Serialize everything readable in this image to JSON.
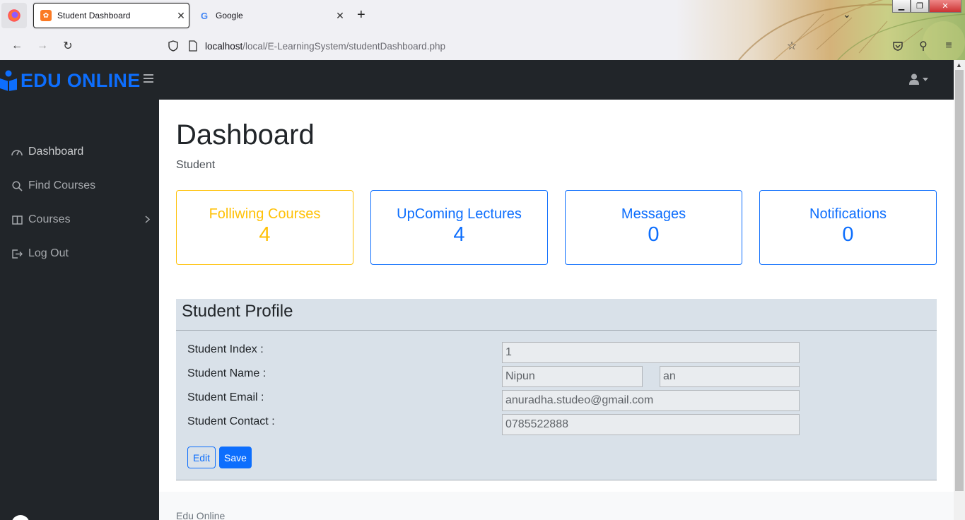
{
  "browser": {
    "tabs": [
      {
        "title": "Student Dashboard",
        "active": true
      },
      {
        "title": "Google",
        "active": false
      }
    ],
    "url_host": "localhost",
    "url_path": "/local/E-LearningSystem/studentDashboard.php"
  },
  "colors": {
    "primary": "#0d6efd",
    "warning": "#ffc107",
    "sidebar": "#212529",
    "profile_bg": "#d9e1e9"
  },
  "brand": {
    "name": "EDU ONLINE"
  },
  "sidebar": {
    "items": [
      {
        "label": "Dashboard",
        "icon": "dashboard-icon"
      },
      {
        "label": "Find Courses",
        "icon": "search-icon"
      },
      {
        "label": "Courses",
        "icon": "columns-icon"
      },
      {
        "label": "Log Out",
        "icon": "logout-icon"
      }
    ]
  },
  "main": {
    "title": "Dashboard",
    "breadcrumb": "Student",
    "stats": [
      {
        "label": "Folliwing Courses",
        "value": "4"
      },
      {
        "label": "UpComing Lectures",
        "value": "4"
      },
      {
        "label": "Messages",
        "value": "0"
      },
      {
        "label": "Notifications",
        "value": "0"
      }
    ]
  },
  "profile": {
    "heading": "Student Profile",
    "index_label": "Student Index :",
    "index_value": "1",
    "name_label": "Student Name :",
    "first_name": "Nipun",
    "last_name": "an",
    "email_label": "Student Email :",
    "email_value": "anuradha.studeo@gmail.com",
    "contact_label": "Student Contact :",
    "contact_value": "0785522888",
    "edit_label": "Edit",
    "save_label": "Save"
  },
  "footer": {
    "text": "Edu Online"
  }
}
